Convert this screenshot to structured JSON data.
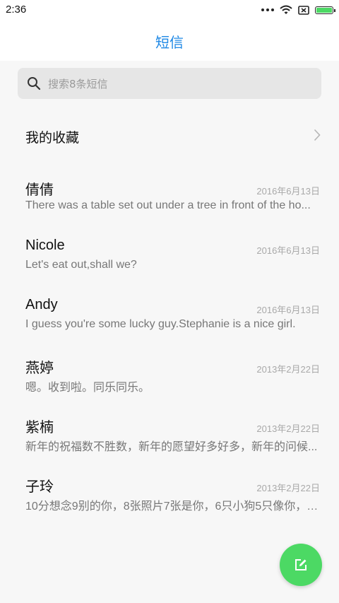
{
  "status_bar": {
    "time": "2:36",
    "icons": [
      "more-dots-icon",
      "wifi-icon",
      "no-sim-icon",
      "battery-icon"
    ]
  },
  "header": {
    "title": "短信"
  },
  "search": {
    "placeholder": "搜索8条短信"
  },
  "favorites": {
    "label": "我的收藏"
  },
  "messages": [
    {
      "name": "倩倩",
      "date": "2016年6月13日",
      "preview": "There was a table set out under a tree in front of the ho..."
    },
    {
      "name": "Nicole",
      "date": "2016年6月13日",
      "preview": "Let's eat out,shall we?"
    },
    {
      "name": "Andy",
      "date": "2016年6月13日",
      "preview": "I guess you're some lucky guy.Stephanie is a nice girl."
    },
    {
      "name": "燕婷",
      "date": "2013年2月22日",
      "preview": "嗯。收到啦。同乐同乐。"
    },
    {
      "name": "紫楠",
      "date": "2013年2月22日",
      "preview": "新年的祝福数不胜数，新年的愿望好多好多，新年的问候..."
    },
    {
      "name": "子玲",
      "date": "2013年2月22日",
      "preview": "10分想念9别的你，8张照片7张是你，6只小狗5只像你，4..."
    }
  ],
  "fab": {
    "icon": "compose-icon"
  },
  "colors": {
    "accent": "#1e88e5",
    "fab": "#4cd964"
  }
}
